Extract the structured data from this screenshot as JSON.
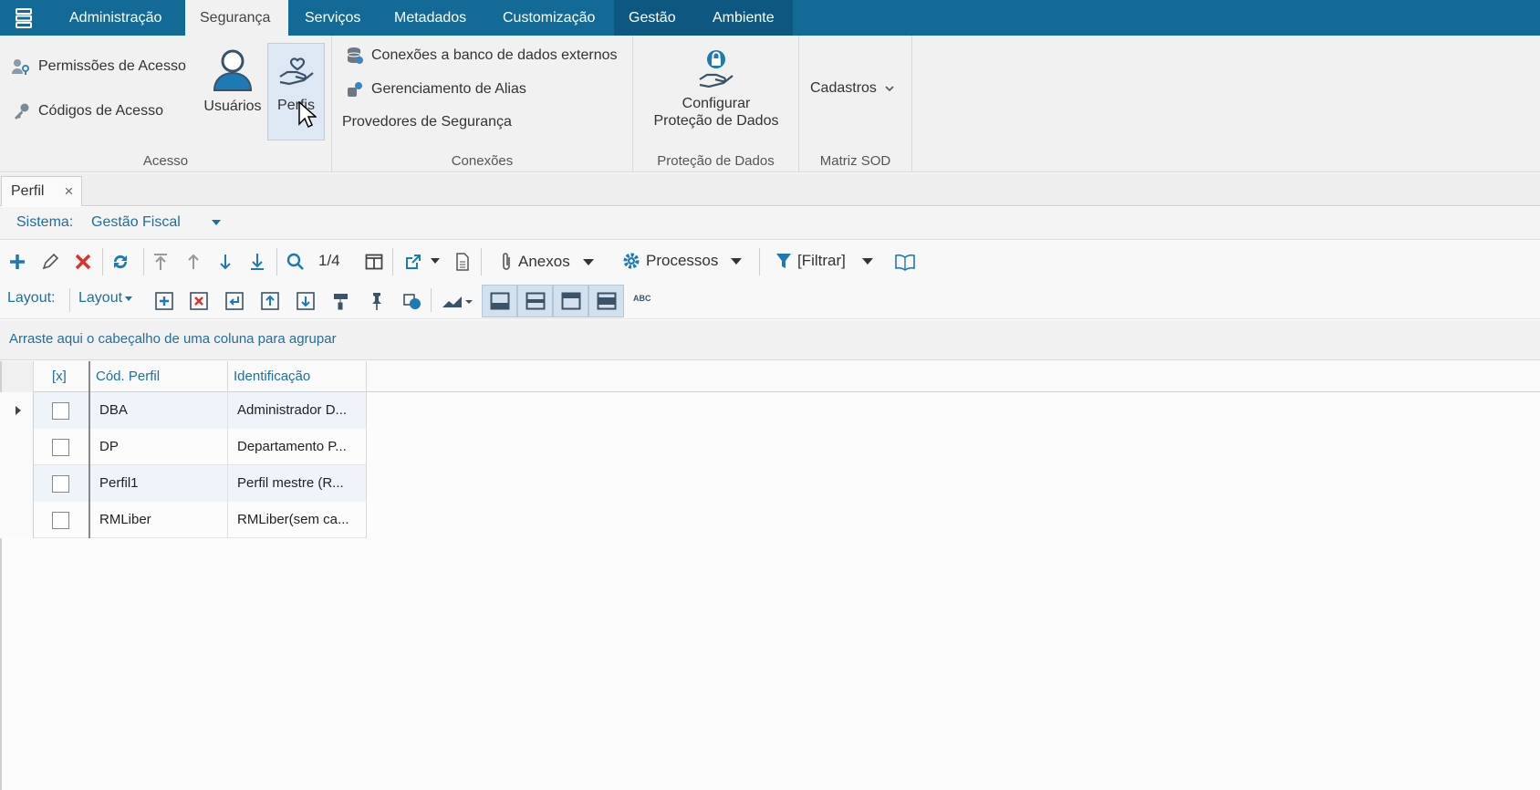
{
  "menubar": {
    "tabs": [
      {
        "label": "Administração"
      },
      {
        "label": "Segurança"
      },
      {
        "label": "Serviços"
      },
      {
        "label": "Metadados"
      },
      {
        "label": "Customização"
      },
      {
        "label": "Gestão"
      },
      {
        "label": "Ambiente"
      }
    ],
    "active_tab": "Segurança"
  },
  "ribbon": {
    "acesso": {
      "label": "Acesso",
      "permissoes": "Permissões de Acesso",
      "codigos": "Códigos de Acesso",
      "usuarios": "Usuários",
      "perfis": "Perfis"
    },
    "conexoes": {
      "label": "Conexões",
      "banco_externo": "Conexões a banco de dados externos",
      "alias": "Gerenciamento de Alias",
      "provedores": "Provedores de Segurança"
    },
    "protecao": {
      "label": "Proteção de Dados",
      "configurar_line1": "Configurar",
      "configurar_line2": "Proteção de Dados"
    },
    "matriz": {
      "label": "Matriz SOD",
      "cadastros": "Cadastros"
    }
  },
  "doc_tab": {
    "label": "Perfil",
    "close": "×"
  },
  "system": {
    "label": "Sistema:",
    "value": "Gestão Fiscal"
  },
  "toolbar": {
    "record_position": "1/4",
    "anexos": "Anexos",
    "processos": "Processos",
    "filtrar": "[Filtrar]",
    "layout_label": "Layout:",
    "layout_dropdown": "Layout",
    "abc": "ABC"
  },
  "group_hint": "Arraste aqui o cabeçalho de uma coluna para agrupar",
  "grid": {
    "columns": [
      "[x]",
      "Cód. Perfil",
      "Identificação"
    ],
    "rows": [
      {
        "code": "DBA",
        "identification": "Administrador D..."
      },
      {
        "code": "DP",
        "identification": "Departamento P..."
      },
      {
        "code": "Perfil1",
        "identification": "Perfil mestre (R..."
      },
      {
        "code": "RMLiber",
        "identification": "RMLiber(sem ca..."
      }
    ]
  },
  "colors": {
    "menubar": "#146a96",
    "accent_text": "#1e6fa0",
    "delete": "#d9342b"
  }
}
